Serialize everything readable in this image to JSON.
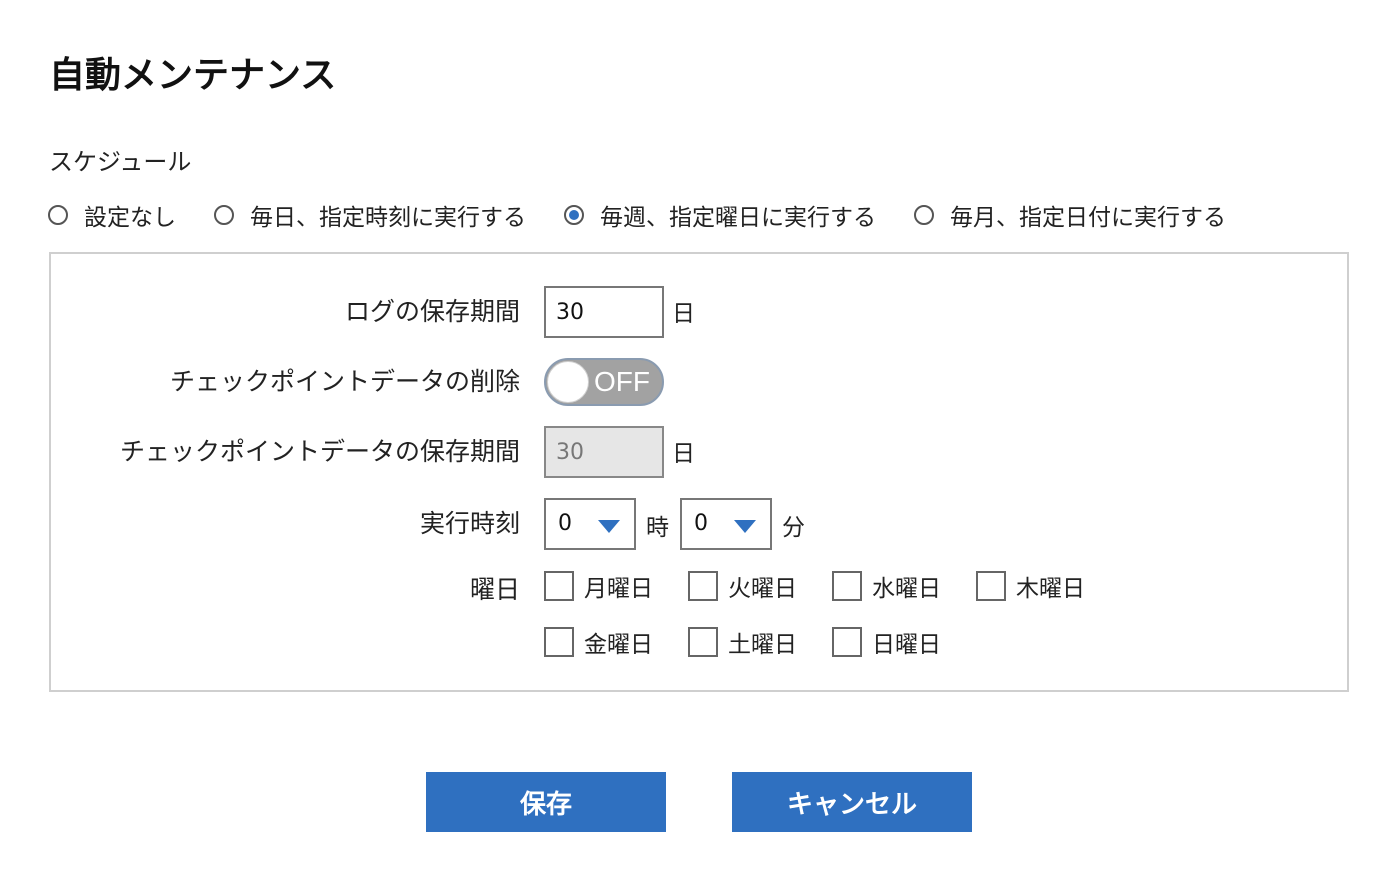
{
  "page": {
    "title": "自動メンテナンス"
  },
  "schedule": {
    "label": "スケジュール",
    "options": [
      {
        "label": "設定なし",
        "checked": false
      },
      {
        "label": "毎日、指定時刻に実行する",
        "checked": false
      },
      {
        "label": "毎週、指定曜日に実行する",
        "checked": true
      },
      {
        "label": "毎月、指定日付に実行する",
        "checked": false
      }
    ]
  },
  "settings": {
    "log_retention": {
      "label": "ログの保存期間",
      "value": "30",
      "unit": "日"
    },
    "checkpoint_delete": {
      "label": "チェックポイントデータの削除",
      "state": "OFF"
    },
    "checkpoint_retention": {
      "label": "チェックポイントデータの保存期間",
      "value": "30",
      "unit": "日",
      "disabled": true
    },
    "run_time": {
      "label": "実行時刻",
      "hour": "0",
      "hour_unit": "時",
      "minute": "0",
      "minute_unit": "分"
    },
    "weekdays": {
      "label": "曜日",
      "days": [
        {
          "label": "月曜日",
          "checked": false
        },
        {
          "label": "火曜日",
          "checked": false
        },
        {
          "label": "水曜日",
          "checked": false
        },
        {
          "label": "木曜日",
          "checked": false
        },
        {
          "label": "金曜日",
          "checked": false
        },
        {
          "label": "土曜日",
          "checked": false
        },
        {
          "label": "日曜日",
          "checked": false
        }
      ]
    }
  },
  "actions": {
    "save_label": "保存",
    "cancel_label": "キャンセル"
  },
  "colors": {
    "accent": "#2f70c0",
    "toggle_off": "#a2a2a2",
    "panel_border": "#cfcfcf"
  }
}
